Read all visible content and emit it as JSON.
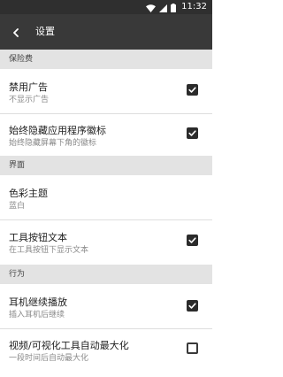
{
  "status_bar": {
    "time": "11:32",
    "icons": [
      "wifi-icon",
      "signal-icon",
      "battery-icon"
    ]
  },
  "toolbar": {
    "back_icon": "arrow-back-icon",
    "title": "设置"
  },
  "sections": [
    {
      "header": "保险费",
      "items": [
        {
          "title": "禁用广告",
          "summary": "不显示广告",
          "checked": true
        },
        {
          "title": "始终隐藏应用程序徽标",
          "summary": "始终隐藏屏幕下角的徽标",
          "checked": true
        }
      ]
    },
    {
      "header": "界面",
      "items": [
        {
          "title": "色彩主题",
          "summary": "蓝白"
        },
        {
          "title": "工具按钮文本",
          "summary": "在工具按钮下显示文本",
          "checked": true
        }
      ]
    },
    {
      "header": "行为",
      "items": [
        {
          "title": "耳机继续播放",
          "summary": "插入耳机后继续",
          "checked": true
        },
        {
          "title": "视频/可视化工具自动最大化",
          "summary": "一段时间后自动最大化",
          "checked": false
        }
      ]
    }
  ],
  "colors": {
    "status_bar": "#2f2f2f",
    "toolbar": "#393939",
    "section_header_bg": "#e3e3e3",
    "checkbox": "#2b2b2b"
  }
}
